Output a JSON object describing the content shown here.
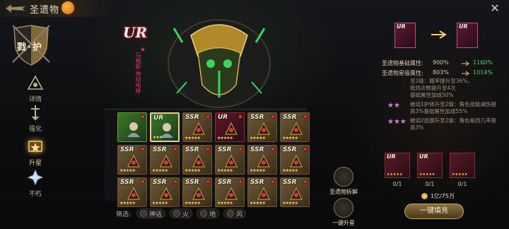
{
  "header": {
    "title": "圣遗物"
  },
  "left_nav": {
    "crest_text": "戮·护",
    "items": [
      {
        "label": "详情",
        "icon": "detail-icon",
        "active": false
      },
      {
        "label": "强化",
        "icon": "enhance-icon",
        "active": false
      },
      {
        "label": "升星",
        "icon": "star-up-icon",
        "active": true
      },
      {
        "label": "不朽",
        "icon": "immortal-icon",
        "active": false
      }
    ]
  },
  "relic": {
    "rarity": "UR",
    "name": "马格斯·地狱咆哮",
    "glow_color": "#3ad65c"
  },
  "grid": {
    "rows": [
      [
        {
          "rarity": "",
          "stars": "",
          "type": "hero",
          "selected": false,
          "dot": true
        },
        {
          "rarity": "UR",
          "stars": "★★★",
          "type": "hero",
          "selected": true,
          "dot": false
        },
        {
          "rarity": "SSR",
          "stars": "★★★★★",
          "type": "ssr",
          "selected": false,
          "dot": true
        },
        {
          "rarity": "UR",
          "stars": "★★★★★",
          "type": "ur",
          "selected": false,
          "dot": true
        },
        {
          "rarity": "SSR",
          "stars": "★★★★★",
          "type": "ssr",
          "selected": false,
          "dot": true
        },
        {
          "rarity": "SSR",
          "stars": "★★★★★",
          "type": "ssr",
          "selected": false,
          "dot": true
        }
      ],
      [
        {
          "rarity": "SSR",
          "stars": "★★★★★",
          "type": "ssr",
          "selected": false,
          "dot": true
        },
        {
          "rarity": "SSR",
          "stars": "★★★★★",
          "type": "ssr",
          "selected": false,
          "dot": true
        },
        {
          "rarity": "SSR",
          "stars": "★★★★★",
          "type": "ssr",
          "selected": false,
          "dot": true
        },
        {
          "rarity": "SSR",
          "stars": "★★★★★",
          "type": "ssr",
          "selected": false,
          "dot": true
        },
        {
          "rarity": "SSR",
          "stars": "★★★★★",
          "type": "ssr",
          "selected": false,
          "dot": true
        },
        {
          "rarity": "SSR",
          "stars": "★★★★★",
          "type": "ssr",
          "selected": false,
          "dot": true
        }
      ],
      [
        {
          "rarity": "SSR",
          "stars": "★★★★★",
          "type": "ssr",
          "selected": false,
          "dot": true
        },
        {
          "rarity": "SSR",
          "stars": "★★★★★",
          "type": "ssr",
          "selected": false,
          "dot": true
        },
        {
          "rarity": "SSR",
          "stars": "★★★★★",
          "type": "ssr",
          "selected": false,
          "dot": true
        },
        {
          "rarity": "SSR",
          "stars": "★★★★★",
          "type": "ssr",
          "selected": false,
          "dot": true
        },
        {
          "rarity": "SSR",
          "stars": "★★★★★",
          "type": "ssr",
          "selected": false,
          "dot": true
        },
        {
          "rarity": "SSR",
          "stars": "★★★★★",
          "type": "ssr",
          "selected": false,
          "dot": true
        }
      ]
    ]
  },
  "filter": {
    "label": "筛选:",
    "chips": [
      "神话",
      "火",
      "地",
      "风"
    ]
  },
  "actions": {
    "dismantle": "圣遗物拆解",
    "one_key_star": "一键升星"
  },
  "right": {
    "from_rarity": "UR",
    "to_rarity": "UR",
    "attrs": [
      {
        "label": "圣遗物基础属性:",
        "old": "900%",
        "new": "1160%"
      },
      {
        "label": "圣遗物星级属性:",
        "old": "803%",
        "new": "1014%"
      }
    ],
    "desc_lines": [
      "至2级：概率提升至36%，",
      "抵挡次数提升至4次",
      "基础属性加成50%"
    ],
    "star_tiers": [
      {
        "stars": "★★",
        "text": "被动1护体升至2级：角色技能减伤提高3%基础属性加成55%"
      },
      {
        "stars": "★★★",
        "text": "被动2抵御升至2级：角色格挡几率提高3%"
      }
    ],
    "materials": [
      {
        "rarity": "UR",
        "count": "0/1"
      },
      {
        "rarity": "UR",
        "count": "0/1"
      },
      {
        "rarity": "",
        "count": "0/1"
      }
    ],
    "cost": "1亿/75万",
    "fill_label": "一键填充"
  }
}
